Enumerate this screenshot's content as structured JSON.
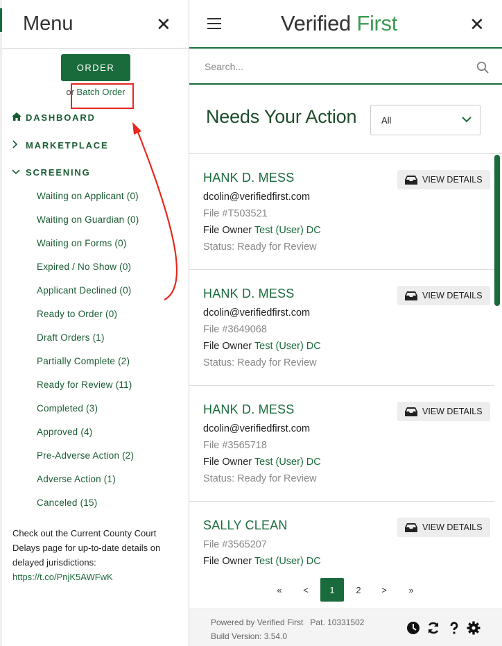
{
  "menu": {
    "title": "Menu",
    "order_label": "ORDER",
    "batch_prefix": "or",
    "batch_label": "Batch Order",
    "nav": {
      "dashboard": "DASHBOARD",
      "marketplace": "MARKETPLACE",
      "screening": "SCREENING"
    },
    "screening_items": [
      "Waiting on Applicant (0)",
      "Waiting on Guardian (0)",
      "Waiting on Forms (0)",
      "Expired / No Show (0)",
      "Applicant Declined (0)",
      "Ready to Order (0)",
      "Draft Orders (1)",
      "Partially Complete (2)",
      "Ready for Review (11)",
      "Completed (3)",
      "Approved (4)",
      "Pre-Adverse Action (2)",
      "Adverse Action (1)",
      "Canceled (15)"
    ],
    "news_text": "Check out the Current County Court Delays page for up-to-date details on delayed jurisdictions:",
    "news_link": "https://t.co/PnjK5AWFwK"
  },
  "header": {
    "logo_part1": "Verified",
    "logo_part2": " First"
  },
  "search": {
    "placeholder": "Search..."
  },
  "main": {
    "title": "Needs Your Action",
    "filter_value": "All",
    "view_details_label": "VIEW DETAILS",
    "file_owner_label": "File Owner",
    "cards": [
      {
        "name": "HANK D. MESS",
        "email": "dcolin@verifiedfirst.com",
        "file": "File #T503521",
        "owner": "Test (User) DC",
        "status": "Status: Ready for Review"
      },
      {
        "name": "HANK D. MESS",
        "email": "dcolin@verifiedfirst.com",
        "file": "File #3649068",
        "owner": "Test (User) DC",
        "status": "Status: Ready for Review"
      },
      {
        "name": "HANK D. MESS",
        "email": "dcolin@verifiedfirst.com",
        "file": "File #3565718",
        "owner": "Test (User) DC",
        "status": "Status: Ready for Review"
      },
      {
        "name": "SALLY CLEAN",
        "file": "File #3565207",
        "owner": "Test (User) DC"
      }
    ]
  },
  "pagination": {
    "first": "«",
    "prev": "<",
    "pages": [
      "1",
      "2"
    ],
    "next": ">",
    "last": "»"
  },
  "footer": {
    "powered": "Powered by Verified First",
    "patent": "Pat. 10331502",
    "build": "Build Version: 3.54.0"
  },
  "colors": {
    "brand_green": "#1a6b3c",
    "logo_green": "#3e9a53",
    "annotation_red": "#e5281c"
  }
}
